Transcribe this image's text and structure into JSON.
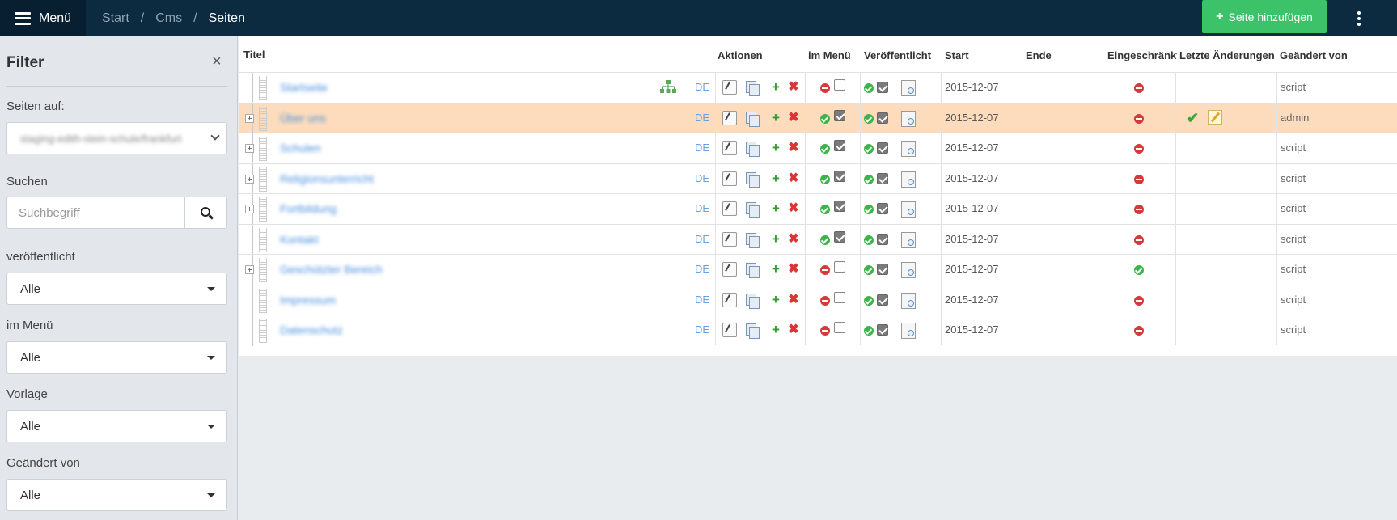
{
  "topbar": {
    "menu_label": "Menü",
    "breadcrumb": [
      "Start",
      "Cms",
      "Seiten"
    ],
    "breadcrumb_sep": "/",
    "add_button": "Seite hinzufügen",
    "add_plus": "+"
  },
  "sidebar": {
    "title": "Filter",
    "close": "×",
    "pages_on_label": "Seiten auf:",
    "pages_on_value": "staging-edith-stein-schule/frankfurt",
    "search_label": "Suchen",
    "search_placeholder": "Suchbegriff",
    "published_label": "veröffentlicht",
    "published_value": "Alle",
    "in_menu_label": "im Menü",
    "in_menu_value": "Alle",
    "template_label": "Vorlage",
    "template_value": "Alle",
    "changed_by_label": "Geändert von",
    "changed_by_value": "Alle"
  },
  "table": {
    "headers": {
      "title": "Titel",
      "actions": "Aktionen",
      "in_menu": "im Menü",
      "published": "Veröffentlicht",
      "start": "Start",
      "end": "Ende",
      "restricted": "Eingeschränkt",
      "last_changes": "Letzte Änderungen",
      "changed_by": "Geändert von"
    },
    "rows": [
      {
        "title": "Startseite",
        "lang": "DE",
        "in_menu": false,
        "published": true,
        "start": "2015-12-07",
        "restricted": false,
        "changed_by": "script",
        "expandable": false,
        "highlight": false,
        "sitemap": true,
        "changes": false
      },
      {
        "title": "Über uns",
        "lang": "DE",
        "in_menu": true,
        "published": true,
        "start": "2015-12-07",
        "restricted": false,
        "changed_by": "admin",
        "expandable": true,
        "highlight": true,
        "sitemap": false,
        "changes": true
      },
      {
        "title": "Schulen",
        "lang": "DE",
        "in_menu": true,
        "published": true,
        "start": "2015-12-07",
        "restricted": false,
        "changed_by": "script",
        "expandable": true,
        "highlight": false,
        "sitemap": false,
        "changes": false
      },
      {
        "title": "Religionsunterricht",
        "lang": "DE",
        "in_menu": true,
        "published": true,
        "start": "2015-12-07",
        "restricted": false,
        "changed_by": "script",
        "expandable": true,
        "highlight": false,
        "sitemap": false,
        "changes": false
      },
      {
        "title": "Fortbildung",
        "lang": "DE",
        "in_menu": true,
        "published": true,
        "start": "2015-12-07",
        "restricted": false,
        "changed_by": "script",
        "expandable": true,
        "highlight": false,
        "sitemap": false,
        "changes": false
      },
      {
        "title": "Kontakt",
        "lang": "DE",
        "in_menu": true,
        "published": true,
        "start": "2015-12-07",
        "restricted": false,
        "changed_by": "script",
        "expandable": false,
        "highlight": false,
        "sitemap": false,
        "changes": false
      },
      {
        "title": "Geschützter Bereich",
        "lang": "DE",
        "in_menu": false,
        "published": true,
        "start": "2015-12-07",
        "restricted": true,
        "changed_by": "script",
        "expandable": true,
        "highlight": false,
        "sitemap": false,
        "changes": false
      },
      {
        "title": "Impressum",
        "lang": "DE",
        "in_menu": false,
        "published": true,
        "start": "2015-12-07",
        "restricted": false,
        "changed_by": "script",
        "expandable": false,
        "highlight": false,
        "sitemap": false,
        "changes": false
      },
      {
        "title": "Datenschutz",
        "lang": "DE",
        "in_menu": false,
        "published": true,
        "start": "2015-12-07",
        "restricted": false,
        "changed_by": "script",
        "expandable": false,
        "highlight": false,
        "sitemap": false,
        "changes": false
      }
    ]
  },
  "colors": {
    "topbar": "#0c2a40",
    "menu_button": "#081f31",
    "add_button": "#3cc36a",
    "row_highlight": "#fcdcbc",
    "link": "#4a8fe0"
  }
}
